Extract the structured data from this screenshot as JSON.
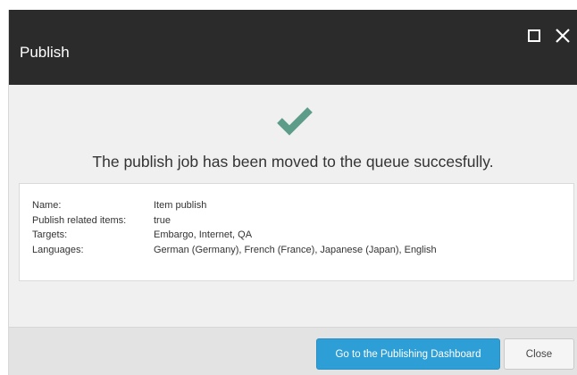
{
  "dialog": {
    "title": "Publish",
    "message": "The publish job has been moved to the queue succesfully.",
    "details": [
      {
        "label": "Name:",
        "value": "Item publish"
      },
      {
        "label": "Publish related items:",
        "value": "true"
      },
      {
        "label": "Targets:",
        "value": "Embargo, Internet, QA"
      },
      {
        "label": "Languages:",
        "value": "German (Germany), French (France), Japanese (Japan), English"
      }
    ],
    "primary_button": "Go to the Publishing Dashboard",
    "secondary_button": "Close"
  },
  "icons": {
    "success": "checkmark-icon",
    "maximize": "maximize-icon",
    "close": "close-icon"
  },
  "colors": {
    "titlebar": "#2b2b2b",
    "success_check": "#5e9c8a",
    "primary_button": "#2e9fd6"
  }
}
